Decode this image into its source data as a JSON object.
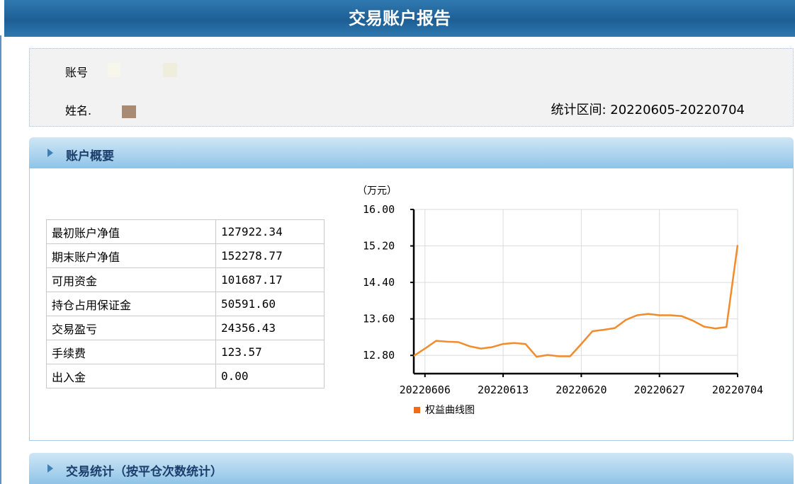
{
  "report": {
    "title": "交易账户报告",
    "account_label": "账号",
    "name_label": "姓名.",
    "period_label": "统计区间:",
    "period_value": "20220605-20220704"
  },
  "section_overview": {
    "title": "账户概要"
  },
  "section_trade": {
    "title": "交易统计（按平仓次数统计）"
  },
  "summary": [
    {
      "label": "最初账户净值",
      "value": "127922.34"
    },
    {
      "label": "期末账户净值",
      "value": "152278.77"
    },
    {
      "label": "可用资金",
      "value": "101687.17"
    },
    {
      "label": "持仓占用保证金",
      "value": "50591.60"
    },
    {
      "label": "交易盈亏",
      "value": "24356.43"
    },
    {
      "label": "手续费",
      "value": "123.57"
    },
    {
      "label": "出入金",
      "value": "0.00"
    }
  ],
  "colors": {
    "line": "#f28b2c",
    "legend_marker": "#f26a1b",
    "header_blue": "#1d5f95"
  },
  "chart_data": {
    "type": "line",
    "unit_label": "（万元）",
    "ylim": [
      12.4,
      16.0
    ],
    "y_ticks": [
      "16.00",
      "15.20",
      "14.40",
      "13.60",
      "12.80"
    ],
    "y_tick_values": [
      16.0,
      15.2,
      14.4,
      13.6,
      12.8
    ],
    "x_range": [
      "20220605",
      "20220704"
    ],
    "x_tick_labels": [
      "20220606",
      "20220613",
      "20220620",
      "20220627",
      "20220704"
    ],
    "grid": true,
    "legend_position": "bottom",
    "series": [
      {
        "name": "权益曲线图",
        "x": [
          "20220605",
          "20220606",
          "20220607",
          "20220608",
          "20220609",
          "20220610",
          "20220611",
          "20220612",
          "20220613",
          "20220614",
          "20220615",
          "20220616",
          "20220617",
          "20220618",
          "20220619",
          "20220620",
          "20220621",
          "20220622",
          "20220623",
          "20220624",
          "20220625",
          "20220626",
          "20220627",
          "20220628",
          "20220629",
          "20220630",
          "20220701",
          "20220702",
          "20220703",
          "20220704"
        ],
        "values": [
          12.79,
          12.95,
          13.12,
          13.1,
          13.09,
          13.0,
          12.95,
          12.98,
          13.05,
          13.07,
          13.05,
          12.77,
          12.81,
          12.78,
          12.78,
          13.05,
          13.33,
          13.36,
          13.4,
          13.58,
          13.68,
          13.71,
          13.68,
          13.68,
          13.66,
          13.56,
          13.43,
          13.39,
          13.42,
          15.22
        ]
      }
    ]
  }
}
